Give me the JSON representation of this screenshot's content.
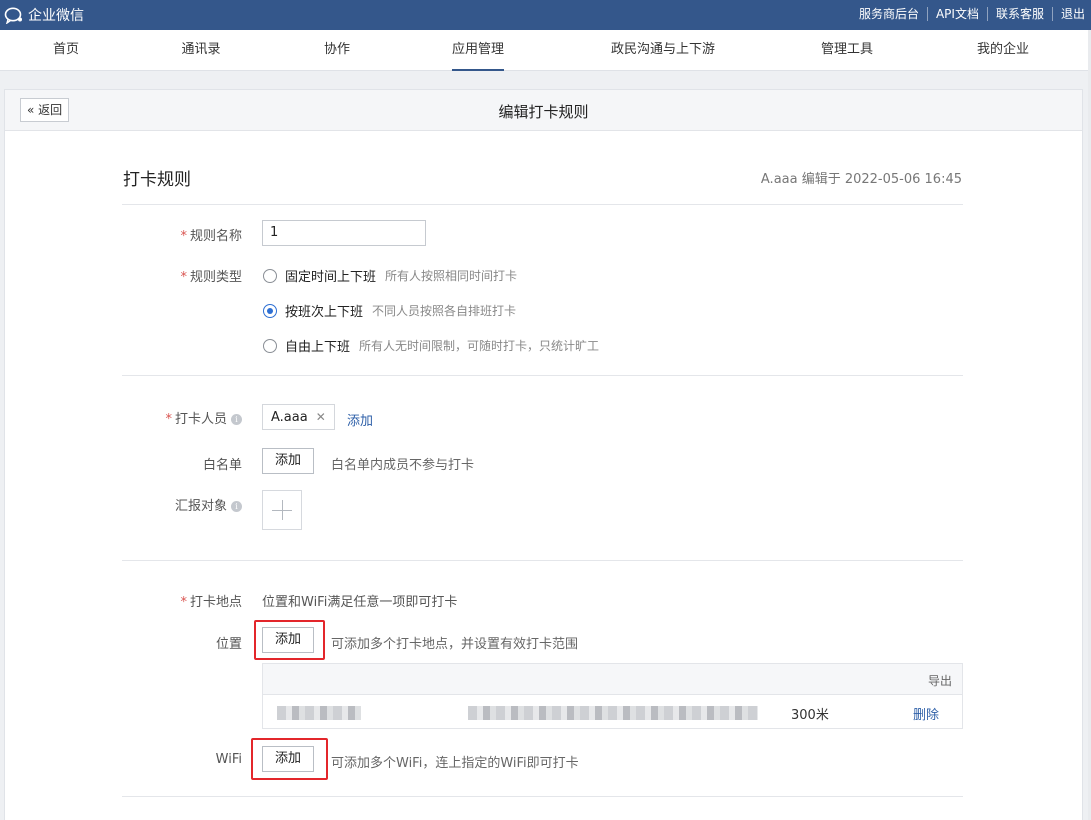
{
  "topbar": {
    "brand": "企业微信",
    "links": [
      "服务商后台",
      "API文档",
      "联系客服",
      "退出"
    ]
  },
  "nav": {
    "items": [
      "首页",
      "通讯录",
      "协作",
      "应用管理",
      "政民沟通与上下游",
      "管理工具",
      "我的企业"
    ],
    "active": "应用管理"
  },
  "panel": {
    "back_label": "返回",
    "title": "编辑打卡规则"
  },
  "section": {
    "title": "打卡规则",
    "edit_info": "A.aaa 编辑于 2022-05-06 16:45"
  },
  "rule_name": {
    "label": "规则名称",
    "value": "1"
  },
  "rule_type": {
    "label": "规则类型",
    "options": [
      {
        "label": "固定时间上下班",
        "desc": "所有人按照相同时间打卡",
        "checked": false
      },
      {
        "label": "按班次上下班",
        "desc": "不同人员按照各自排班打卡",
        "checked": true
      },
      {
        "label": "自由上下班",
        "desc": "所有人无时间限制，可随时打卡，只统计旷工",
        "checked": false
      }
    ]
  },
  "members": {
    "label": "打卡人员",
    "tag": "A.aaa",
    "add_label": "添加"
  },
  "whitelist": {
    "label": "白名单",
    "button": "添加",
    "hint": "白名单内成员不参与打卡"
  },
  "report": {
    "label": "汇报对象"
  },
  "location": {
    "label": "打卡地点",
    "hint": "位置和WiFi满足任意一项即可打卡",
    "position_label": "位置",
    "position_button": "添加",
    "position_hint": "可添加多个打卡地点，并设置有效打卡范围",
    "table": {
      "export_label": "导出",
      "rows": [
        {
          "radius": "300米",
          "delete_label": "删除"
        }
      ]
    },
    "wifi_label": "WiFi",
    "wifi_button": "添加",
    "wifi_hint": "可添加多个WiFi，连上指定的WiFi即可打卡"
  },
  "colors": {
    "topbar": "#34578b",
    "accent": "#2d6fd3",
    "link": "#2d5fa8",
    "highlight": "#e3262b",
    "required": "#d9534f"
  }
}
